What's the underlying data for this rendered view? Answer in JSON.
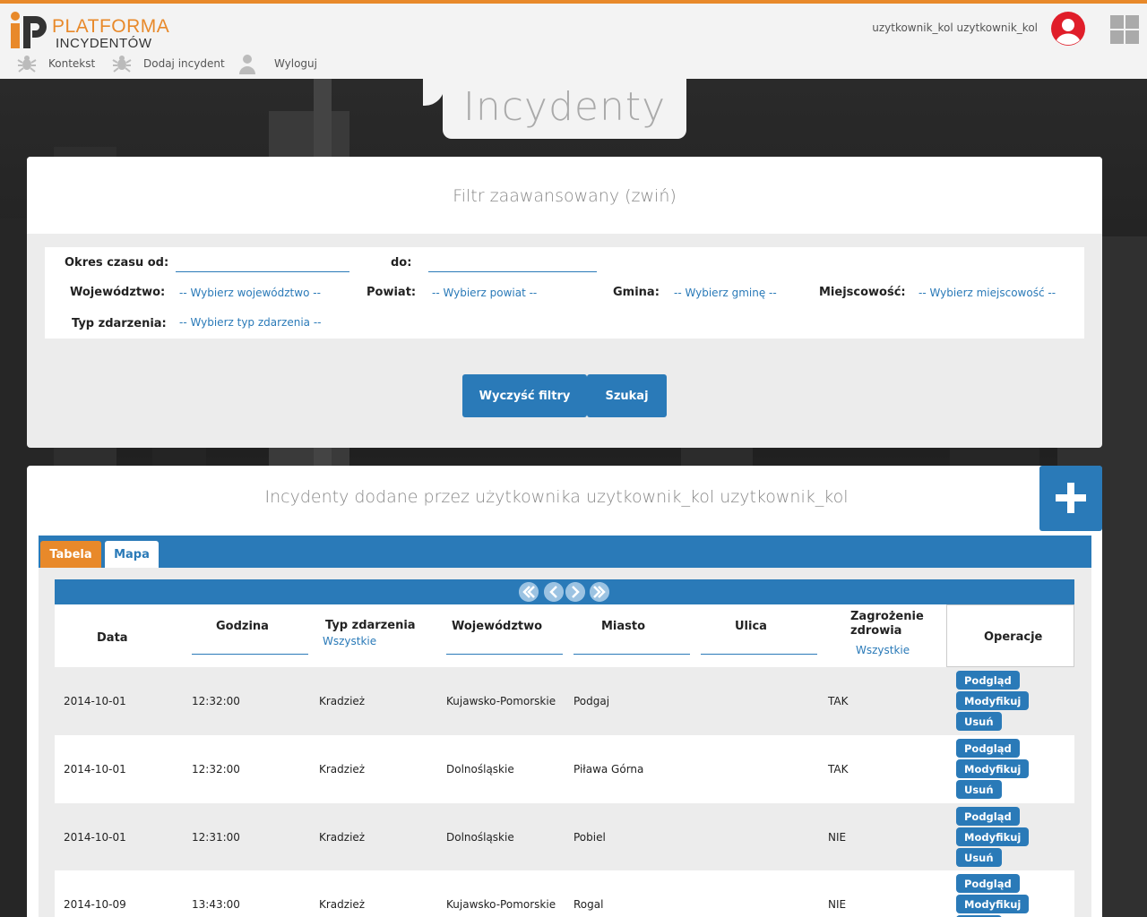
{
  "brand": {
    "line1": "PLATFORMA",
    "line2": "INCYDENTÓW"
  },
  "header": {
    "user_name": "uzytkownik_kol uzytkownik_kol"
  },
  "nav": [
    {
      "label": "Kontekst",
      "icon": "bug-icon"
    },
    {
      "label": "Dodaj incydent",
      "icon": "bug-icon"
    },
    {
      "label": "Wyloguj",
      "icon": "user-icon"
    }
  ],
  "page_title": "Incydenty",
  "filter": {
    "title": "Filtr zaawansowany (zwiń)",
    "period_from_label": "Okres czasu od:",
    "period_to_label": "do:",
    "voivodeship_label": "Województwo:",
    "voivodeship_value": "-- Wybierz województwo --",
    "county_label": "Powiat:",
    "county_value": "-- Wybierz powiat --",
    "commune_label": "Gmina:",
    "commune_value": "-- Wybierz gminę --",
    "locality_label": "Miejscowość:",
    "locality_value": "-- Wybierz miejscowość --",
    "event_type_label": "Typ zdarzenia:",
    "event_type_value": "-- Wybierz typ zdarzenia --",
    "clear_button": "Wyczyść filtry",
    "search_button": "Szukaj"
  },
  "list": {
    "title": "Incydenty dodane przez użytkownika uzytkownik_kol uzytkownik_kol",
    "tabs": [
      {
        "label": "Tabela",
        "active": true
      },
      {
        "label": "Mapa",
        "active": false
      }
    ],
    "columns": {
      "date": "Data",
      "time": "Godzina",
      "type": "Typ zdarzenia",
      "type_filter": "Wszystkie",
      "voivodeship": "Województwo",
      "city": "Miasto",
      "street": "Ulica",
      "health_line1": "Zagrożenie",
      "health_line2": "zdrowia",
      "health_filter": "Wszystkie",
      "operations": "Operacje"
    },
    "op_labels": {
      "view": "Podgląd",
      "edit": "Modyfikuj",
      "delete": "Usuń"
    },
    "rows": [
      {
        "date": "2014-10-01",
        "time": "12:32:00",
        "type": "Kradzież",
        "voivodeship": "Kujawsko-Pomorskie",
        "city": "Podgaj",
        "street": "",
        "health": "TAK"
      },
      {
        "date": "2014-10-01",
        "time": "12:32:00",
        "type": "Kradzież",
        "voivodeship": "Dolnośląskie",
        "city": "Piława Górna",
        "street": "",
        "health": "TAK"
      },
      {
        "date": "2014-10-01",
        "time": "12:31:00",
        "type": "Kradzież",
        "voivodeship": "Dolnośląskie",
        "city": "Pobiel",
        "street": "",
        "health": "NIE"
      },
      {
        "date": "2014-10-09",
        "time": "13:43:00",
        "type": "Kradzież",
        "voivodeship": "Kujawsko-Pomorskie",
        "city": "Rogal",
        "street": "",
        "health": "NIE"
      }
    ]
  },
  "colors": {
    "accent": "#e8892a",
    "primary": "#2a7ab8",
    "avatar": "#e01e2a"
  }
}
